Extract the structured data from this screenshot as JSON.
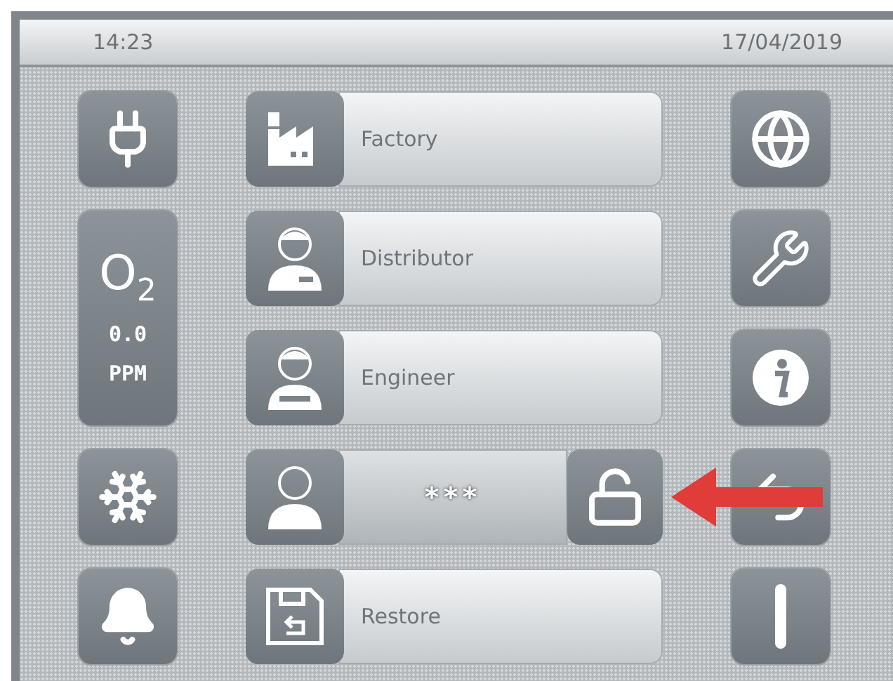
{
  "header": {
    "time": "14:23",
    "date": "17/04/2019"
  },
  "left_tiles": [
    {
      "kind": "eco"
    },
    {
      "kind": "o2",
      "symbol": "O$_{2}$",
      "value": "0.0",
      "unit": "PPM"
    },
    {
      "kind": "snowflake"
    },
    {
      "kind": "bell"
    }
  ],
  "menu_items": [
    {
      "kind": "factory",
      "label": "Factory"
    },
    {
      "kind": "distributor",
      "label": "Distributor"
    },
    {
      "kind": "engineer",
      "label": "Engineer"
    },
    {
      "kind": "password",
      "value": "***"
    },
    {
      "kind": "restore",
      "label": "Restore"
    }
  ],
  "right_tiles": [
    {
      "kind": "globe"
    },
    {
      "kind": "wrench"
    },
    {
      "kind": "info"
    },
    {
      "kind": "back"
    },
    {
      "kind": "power"
    }
  ]
}
